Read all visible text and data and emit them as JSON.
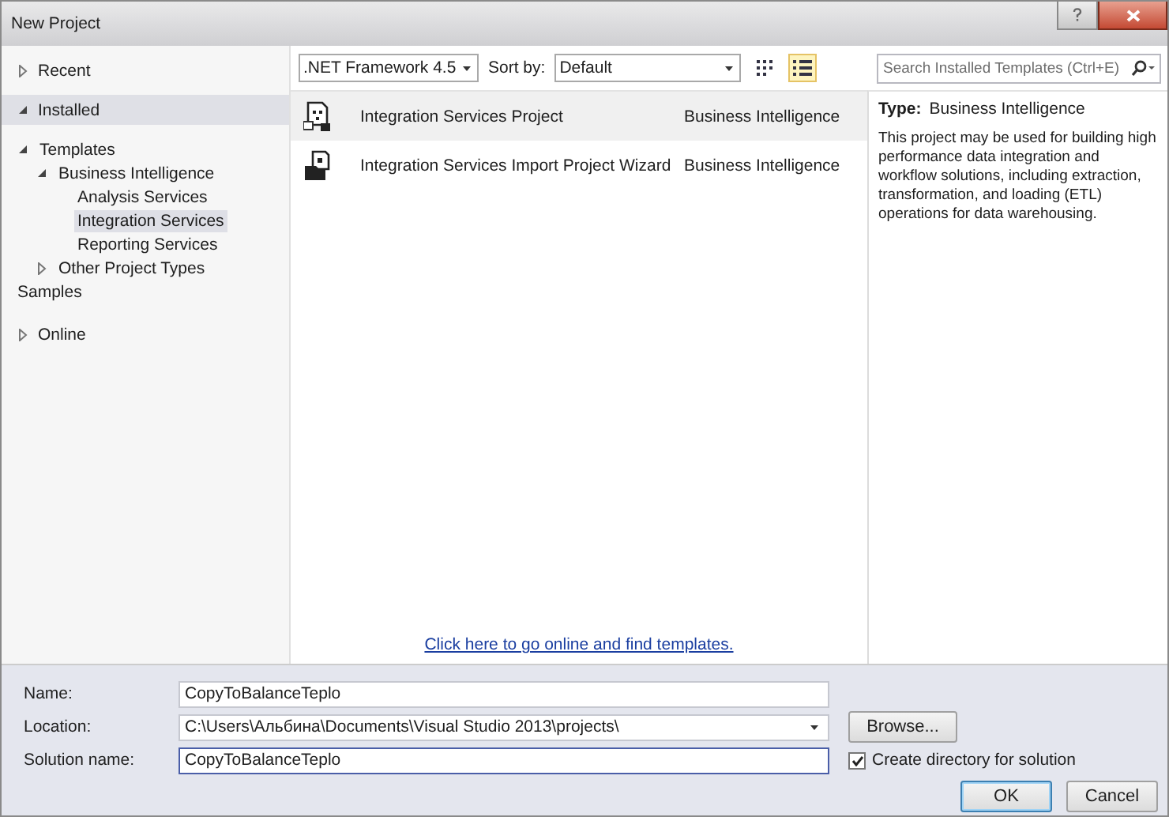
{
  "window": {
    "title": "New Project"
  },
  "sidebar": {
    "sections": [
      {
        "label": "Recent",
        "expanded": false,
        "selected": false
      },
      {
        "label": "Installed",
        "expanded": true,
        "selected": true,
        "children": [
          {
            "label": "Templates",
            "expanded": true,
            "selected": false,
            "children": [
              {
                "label": "Business Intelligence",
                "expanded": true,
                "selected": false,
                "children": [
                  {
                    "label": "Analysis Services",
                    "selected": false
                  },
                  {
                    "label": "Integration Services",
                    "selected": true
                  },
                  {
                    "label": "Reporting Services",
                    "selected": false
                  }
                ]
              },
              {
                "label": "Other Project Types",
                "expanded": false,
                "selected": false
              }
            ]
          },
          {
            "label": "Samples",
            "selected": false
          }
        ]
      },
      {
        "label": "Online",
        "expanded": false,
        "selected": false
      }
    ]
  },
  "toolbar": {
    "framework": ".NET Framework 4.5",
    "sort_label": "Sort by:",
    "sort": "Default",
    "view_modes": [
      {
        "kind": "grid",
        "selected": false
      },
      {
        "kind": "list",
        "selected": true
      }
    ],
    "search": {
      "placeholder": "Search Installed Templates (Ctrl+E)"
    }
  },
  "templates": [
    {
      "name": "Integration Services Project",
      "category": "Business Intelligence",
      "kind": "project",
      "selected": true
    },
    {
      "name": "Integration Services Import Project Wizard",
      "category": "Business Intelligence",
      "kind": "import",
      "selected": false
    }
  ],
  "online_link": "Click here to go online and find templates.",
  "details": {
    "type_label": "Type:",
    "type_value": "Business Intelligence",
    "description": "This project may be used for building high performance data integration and workflow solutions, including extraction, transformation, and loading (ETL) operations for data warehousing."
  },
  "form": {
    "fields": [
      {
        "label": "Name:",
        "value": "CopyToBalanceTeplo",
        "kind": "text",
        "focused": false
      },
      {
        "label": "Location:",
        "value": "C:\\Users\\Альбина\\Documents\\Visual Studio 2013\\projects\\",
        "kind": "dropdown",
        "focused": false
      },
      {
        "label": "Solution name:",
        "value": "CopyToBalanceTeplo",
        "kind": "text",
        "focused": true
      }
    ],
    "browse": "Browse...",
    "create_directory": {
      "label": "Create directory for solution",
      "checked": true
    },
    "buttons": [
      {
        "label": "OK",
        "default": true
      },
      {
        "label": "Cancel",
        "default": false
      }
    ]
  }
}
